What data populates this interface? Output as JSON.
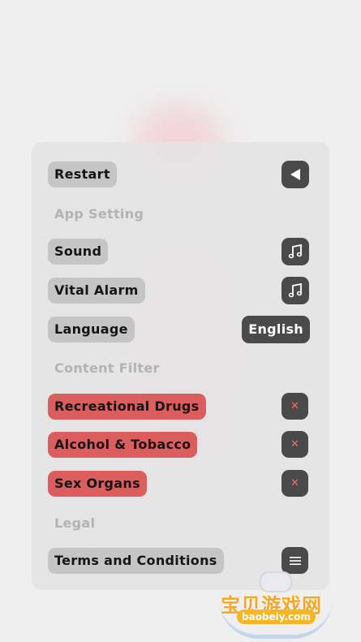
{
  "menu": {
    "restart_label": "Restart",
    "restart_icon": "back-triangle-icon",
    "sections": {
      "app_setting": "App Setting",
      "content_filter": "Content Filter",
      "legal": "Legal"
    },
    "app_settings": [
      {
        "label": "Sound",
        "icon": "music-note-icon"
      },
      {
        "label": "Vital Alarm",
        "icon": "music-note-icon"
      },
      {
        "label": "Language",
        "value": "English"
      }
    ],
    "content_filters": [
      {
        "label": "Recreational Drugs",
        "icon": "close-icon"
      },
      {
        "label": "Alcohol & Tobacco",
        "icon": "close-icon"
      },
      {
        "label": "Sex Organs",
        "icon": "close-icon"
      }
    ],
    "legal_items": [
      {
        "label": "Terms and Conditions",
        "icon": "menu-icon"
      }
    ]
  },
  "watermark": {
    "title": "宝贝游戏网",
    "url": "baobeiy.com"
  },
  "colors": {
    "background": "#efefef",
    "panel": "#e4e4e4",
    "pill": "#c5c5c5",
    "filter_pill": "#dc5d5d",
    "icon_button": "#4a4a4a",
    "section_text": "#b3b3b3",
    "close_icon": "#f06b6b"
  }
}
